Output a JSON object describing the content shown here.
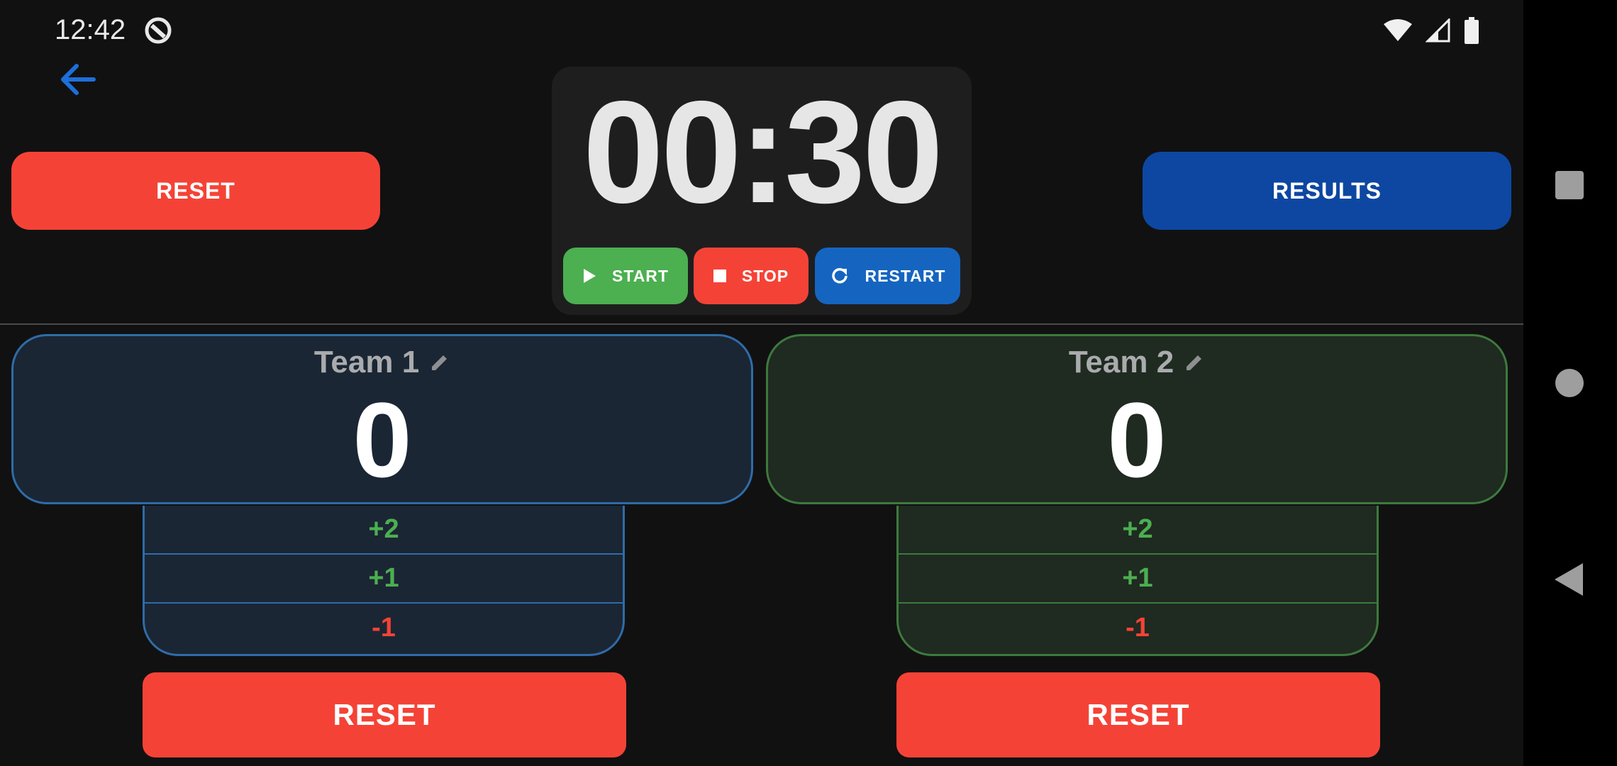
{
  "status_bar": {
    "time": "12:42",
    "icons": [
      "app-notification-icon",
      "wifi-icon",
      "cellular-signal-icon",
      "battery-icon"
    ]
  },
  "header": {
    "back_icon": "back-arrow-icon",
    "reset_label": "RESET",
    "results_label": "RESULTS"
  },
  "timer": {
    "display": "00:30",
    "start_label": "START",
    "stop_label": "STOP",
    "restart_label": "RESTART"
  },
  "teams": [
    {
      "name": "Team 1",
      "score": "0",
      "plus2": "+2",
      "plus1": "+1",
      "minus1": "-1",
      "reset_label": "RESET"
    },
    {
      "name": "Team 2",
      "score": "0",
      "plus2": "+2",
      "plus1": "+1",
      "minus1": "-1",
      "reset_label": "RESET"
    }
  ],
  "colors": {
    "background": "#111112",
    "reset_red": "#f44336",
    "results_blue": "#0d47a1",
    "start_green": "#4caf50",
    "restart_blue": "#1565c0",
    "team1_border": "#2f6ca8",
    "team1_bg": "#1b2634",
    "team2_border": "#3d7a3d",
    "team2_bg": "#1f2a21"
  }
}
